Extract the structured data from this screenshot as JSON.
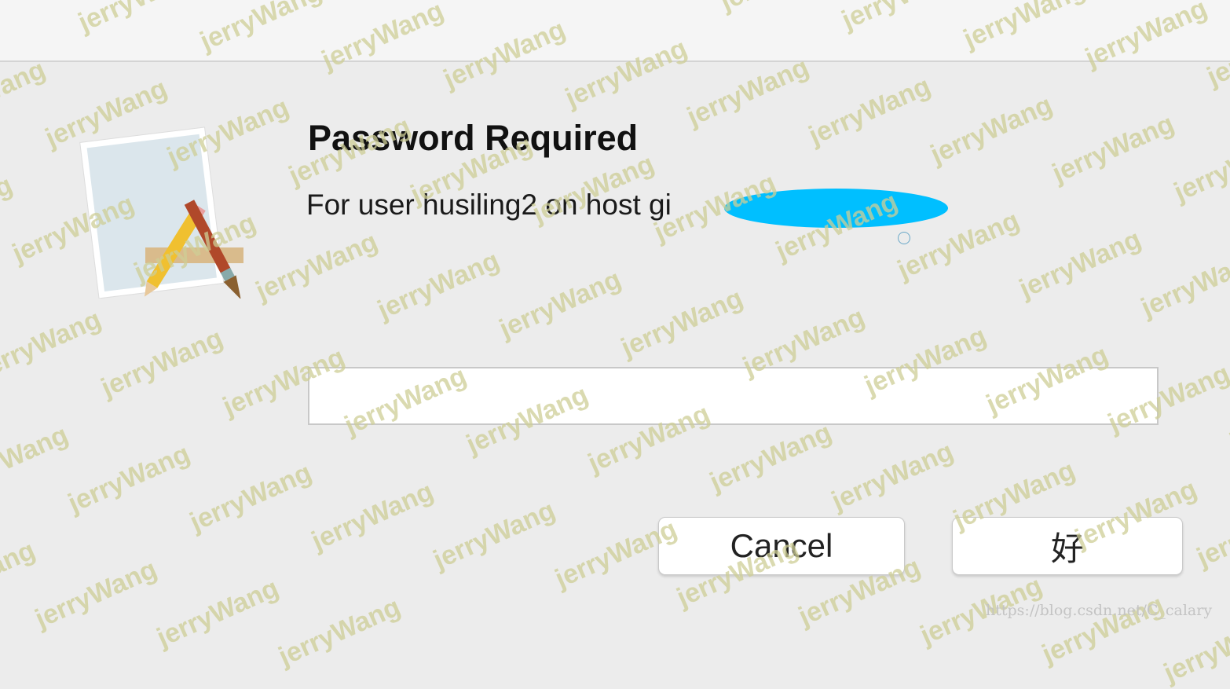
{
  "dialog": {
    "title": "Password Required",
    "message": "For user husiling2 on host gi",
    "message_tail": "on",
    "password_value": "",
    "cancel_label": "Cancel",
    "ok_label": "好",
    "icon": "script-editor-app-icon"
  },
  "watermark": {
    "text": "jerryWang",
    "source_url": "https://blog.csdn.net/C_calary"
  },
  "colors": {
    "redaction": "#00bfff",
    "background": "#ececec"
  }
}
